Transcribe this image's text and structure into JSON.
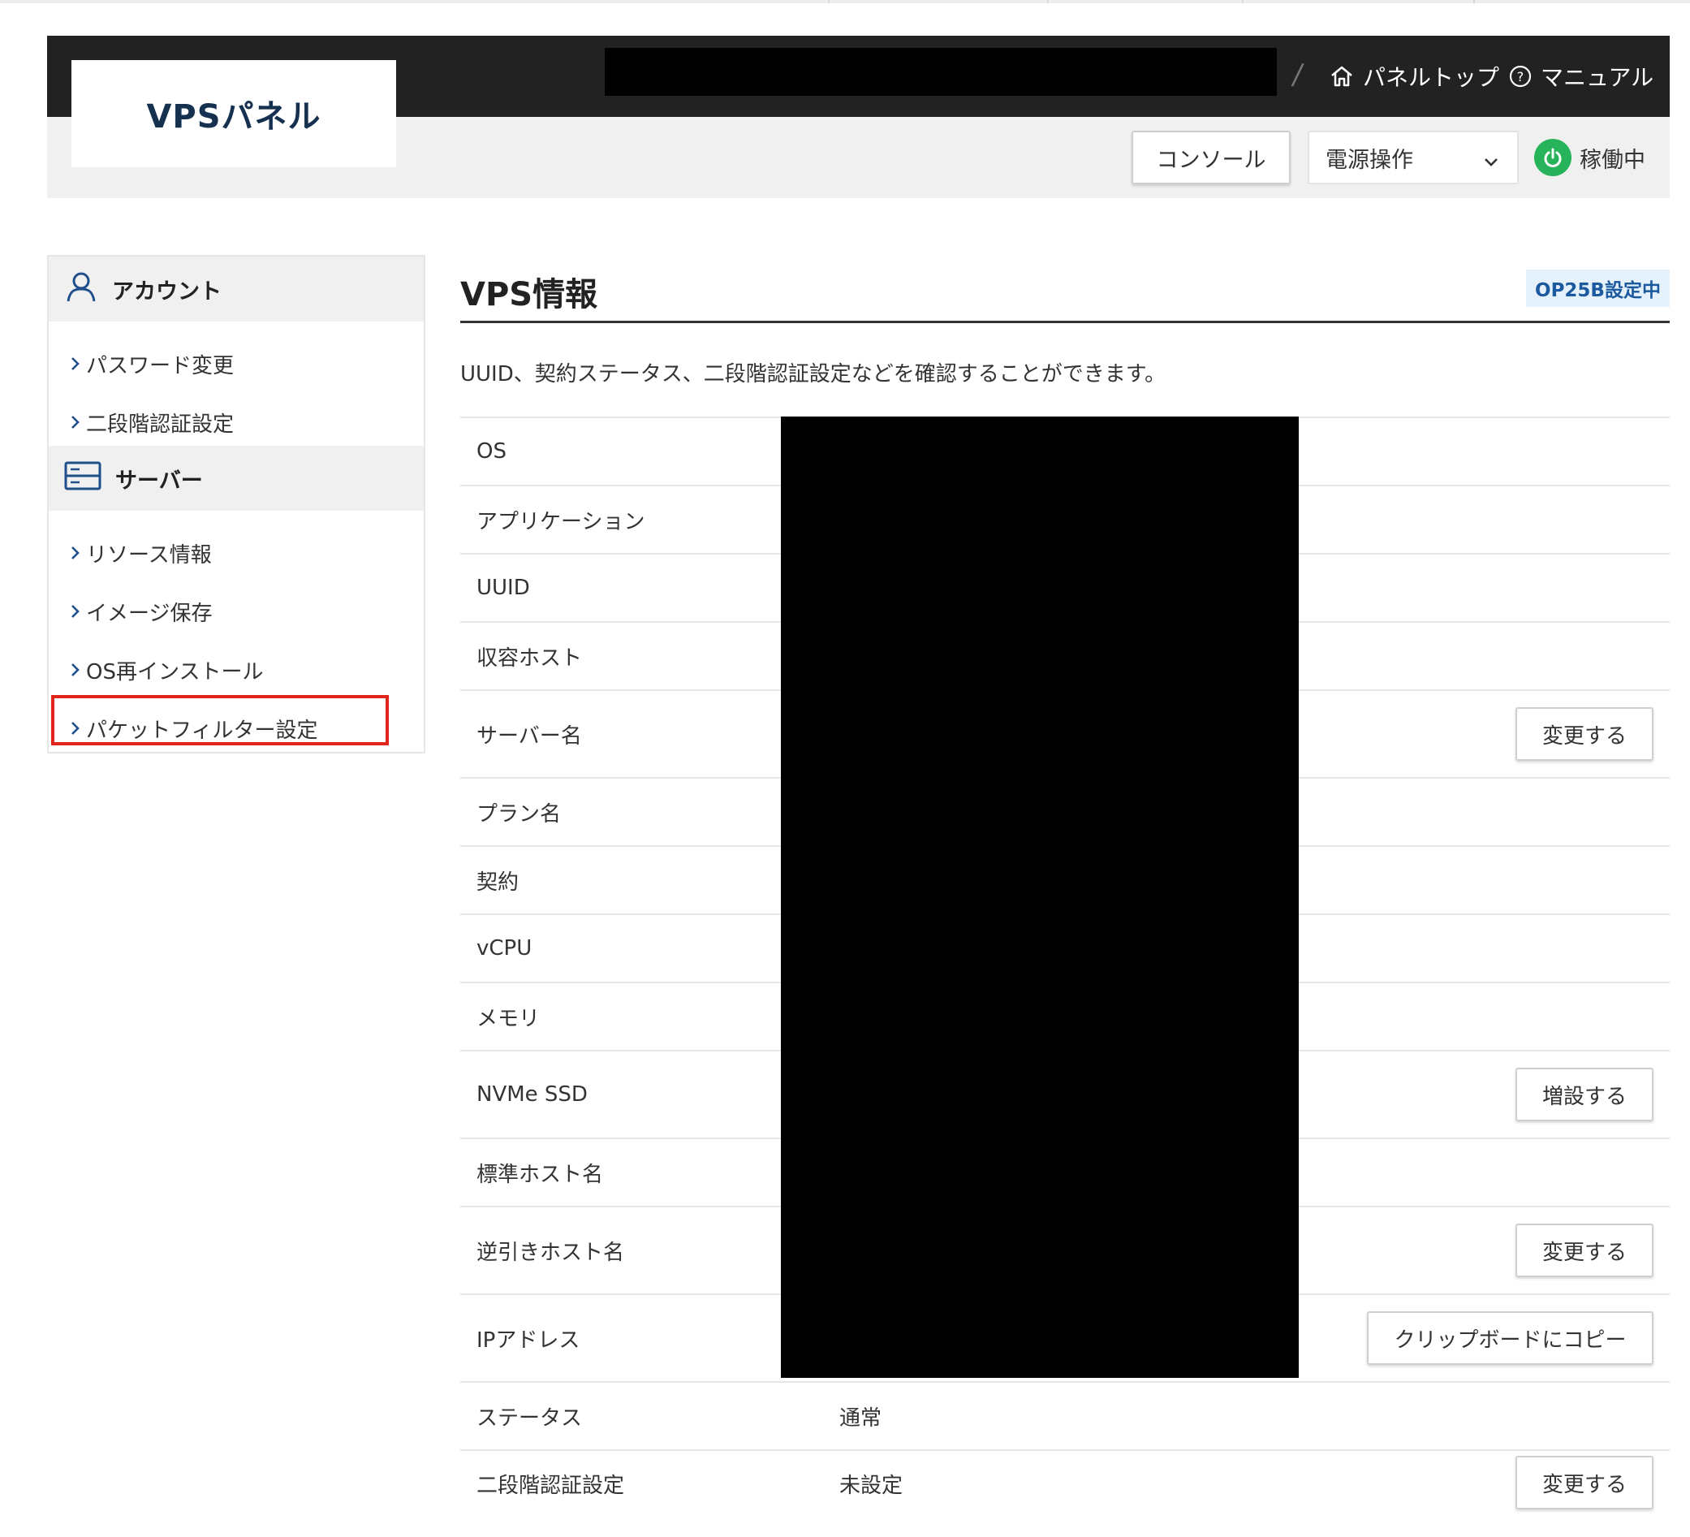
{
  "header": {
    "logo": "VPSパネル",
    "breadcrumb_sep": "/",
    "panel_top": "パネルトップ",
    "manual": "マニュアル",
    "console_button": "コンソール",
    "power_select": "電源操作",
    "status": "稼働中"
  },
  "sidebar": {
    "account_heading": "アカウント",
    "account_items": [
      "パスワード変更",
      "二段階認証設定"
    ],
    "server_heading": "サーバー",
    "server_items": [
      "リソース情報",
      "イメージ保存",
      "OS再インストール",
      "パケットフィルター設定"
    ]
  },
  "main": {
    "title": "VPS情報",
    "badge": "OP25B設定中",
    "description": "UUID、契約ステータス、二段階認証設定などを確認することができます。",
    "rows": [
      {
        "label": "OS"
      },
      {
        "label": "アプリケーション"
      },
      {
        "label": "UUID"
      },
      {
        "label": "収容ホスト"
      },
      {
        "label": "サーバー名",
        "button": "変更する"
      },
      {
        "label": "プラン名"
      },
      {
        "label": "契約"
      },
      {
        "label": "vCPU"
      },
      {
        "label": "メモリ"
      },
      {
        "label": "NVMe SSD",
        "button": "増設する"
      },
      {
        "label": "標準ホスト名"
      },
      {
        "label": "逆引きホスト名",
        "button": "変更する"
      },
      {
        "label": "IPアドレス",
        "button": "クリップボードにコピー"
      },
      {
        "label": "ステータス",
        "value": "通常"
      },
      {
        "label": "二段階認証設定",
        "value": "未設定",
        "button": "変更する"
      }
    ]
  },
  "colors": {
    "header_dark": "#222222",
    "header_light": "#f0f0f0",
    "logo_text": "#16304f",
    "status_green": "#27b35a",
    "badge_bg": "#e5f1fb",
    "badge_text": "#1c5aa0",
    "highlight_red": "#e0261b",
    "icon_blue": "#1e4f8c"
  }
}
